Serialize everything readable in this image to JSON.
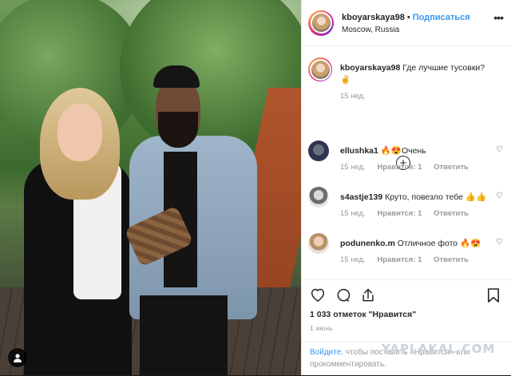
{
  "post": {
    "username": "kboyarskaya98",
    "separator": "•",
    "follow_label": "Подписаться",
    "location": "Moscow, Russia",
    "more_icon": "more-horizontal-icon"
  },
  "caption": {
    "username": "kboyarskaya98",
    "text": "Где лучшие тусовки?",
    "emoji": "✌",
    "time": "15 нед."
  },
  "load_more_icon": "plus-circle-icon",
  "comments": [
    {
      "username": "ellushka1",
      "text": "🔥😍Очень",
      "time": "15 нед.",
      "likes": "Нравится: 1",
      "reply": "Ответить"
    },
    {
      "username": "s4astje139",
      "text": "Круто, повезло тебе 👍👍",
      "time": "15 нед.",
      "likes": "Нравится: 1",
      "reply": "Ответить"
    },
    {
      "username": "podunenko.m",
      "text": "Отличное фото 🔥😍",
      "time": "15 нед.",
      "likes": "Нравится: 1",
      "reply": "Ответить"
    }
  ],
  "actions": {
    "like_icon": "heart-icon",
    "comment_icon": "comment-icon",
    "share_icon": "share-icon",
    "save_icon": "bookmark-icon"
  },
  "likes_text": "1 033 отметок \"Нравится\"",
  "date_text": "1 июнь",
  "footer": {
    "login_link": "Войдите",
    "text_rest": ", чтобы поставить «Нравится» или",
    "text_line2": "прокомментировать."
  },
  "watermark": "YAPLAKAL.COM",
  "colors": {
    "link": "#3897f0",
    "text": "#262626",
    "muted": "#999999"
  }
}
